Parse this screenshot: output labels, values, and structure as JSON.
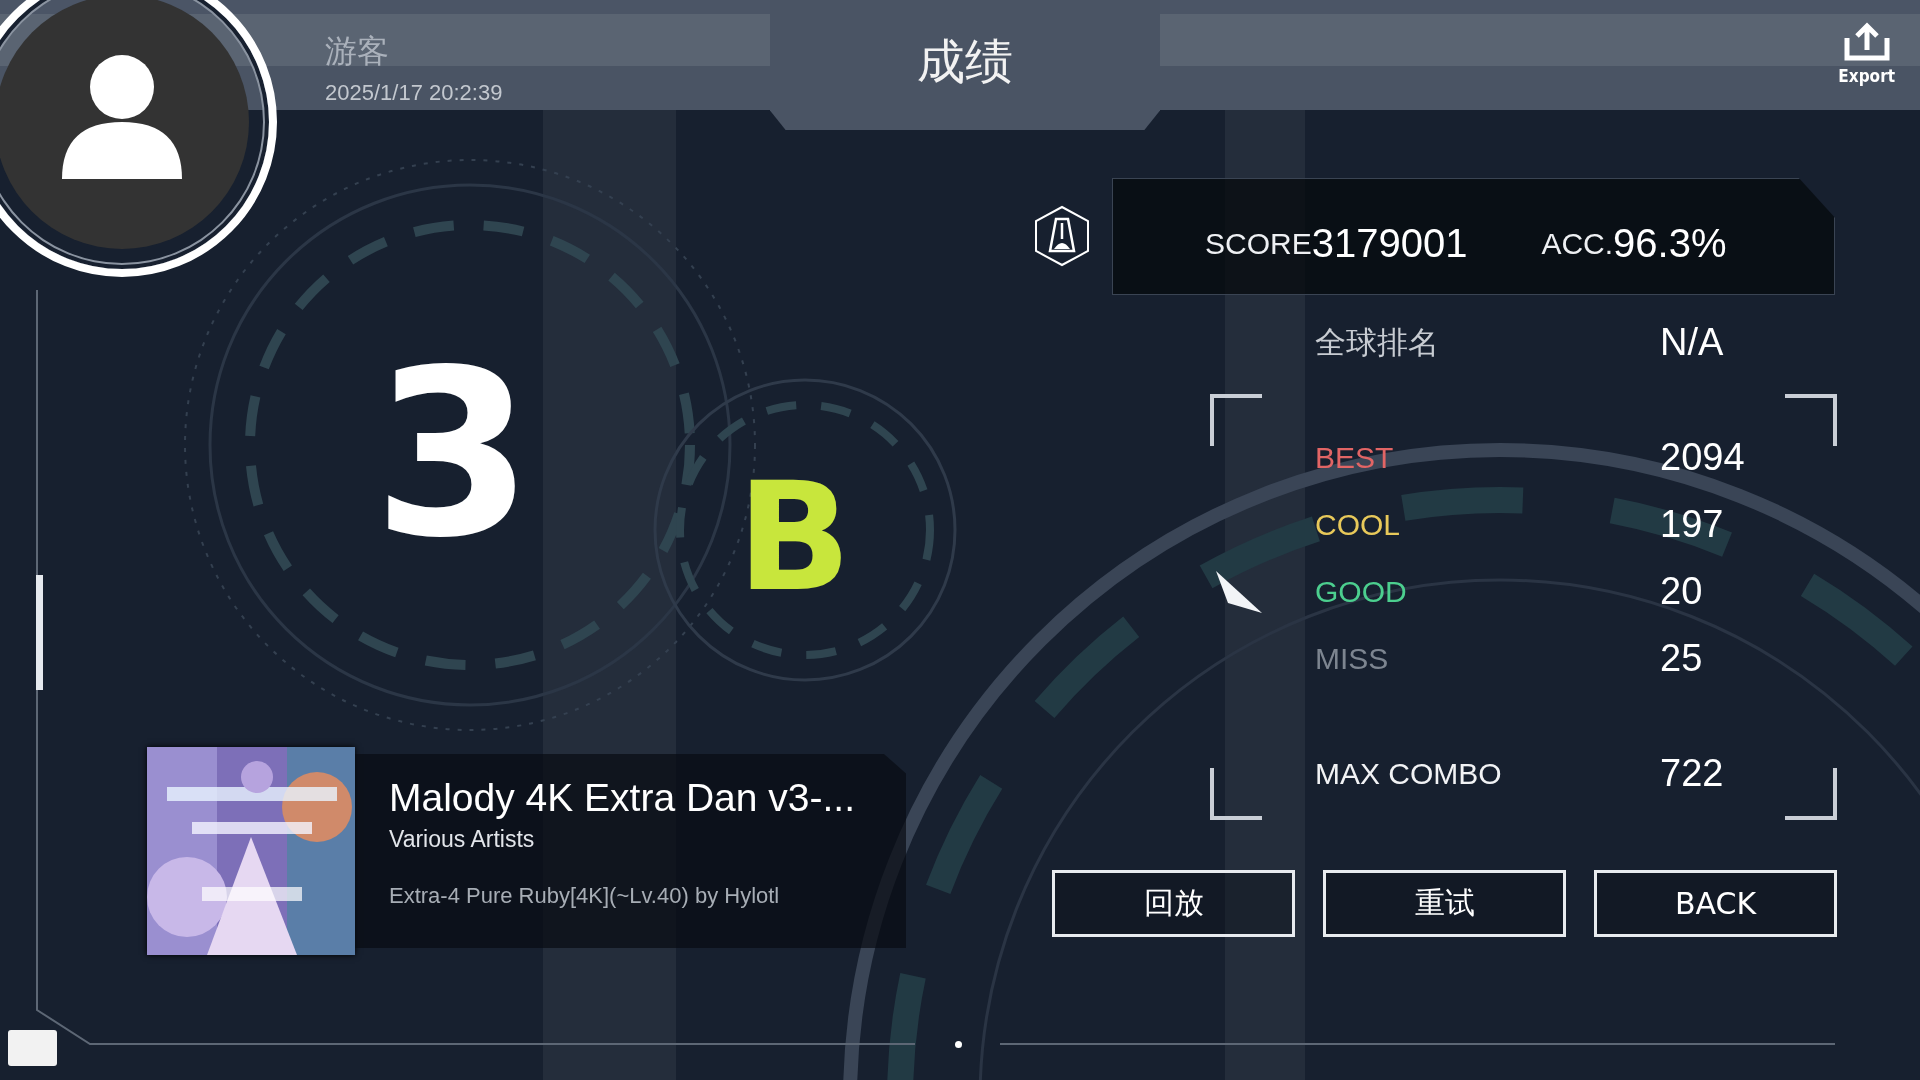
{
  "header": {
    "player": "游客",
    "datetime": "2025/1/17 20:2:39",
    "title": "成绩",
    "export_label": "Export"
  },
  "grade": {
    "numeral": "3",
    "letter": "B"
  },
  "score": {
    "label": "SCORE",
    "value": "3179001",
    "acc_label": "ACC.",
    "acc_value": "96.3%"
  },
  "global_rank": {
    "label": "全球排名",
    "value": "N/A"
  },
  "judgements": [
    {
      "label": "BEST",
      "value": "2094",
      "color": "#e26565"
    },
    {
      "label": "COOL",
      "value": "197",
      "color": "#e8c95a"
    },
    {
      "label": "GOOD",
      "value": "20",
      "color": "#4ccf8f"
    },
    {
      "label": "MISS",
      "value": "25",
      "color": "#7d8590"
    }
  ],
  "max_combo": {
    "label": "MAX COMBO",
    "value": "722"
  },
  "song": {
    "title": "Malody 4K Extra Dan v3-...",
    "artist": "Various Artists",
    "chart": "Extra-4 Pure Ruby[4K](~Lv.40) by Hylotl"
  },
  "buttons": [
    {
      "label": "回放"
    },
    {
      "label": "重试"
    },
    {
      "label": "BACK"
    }
  ]
}
